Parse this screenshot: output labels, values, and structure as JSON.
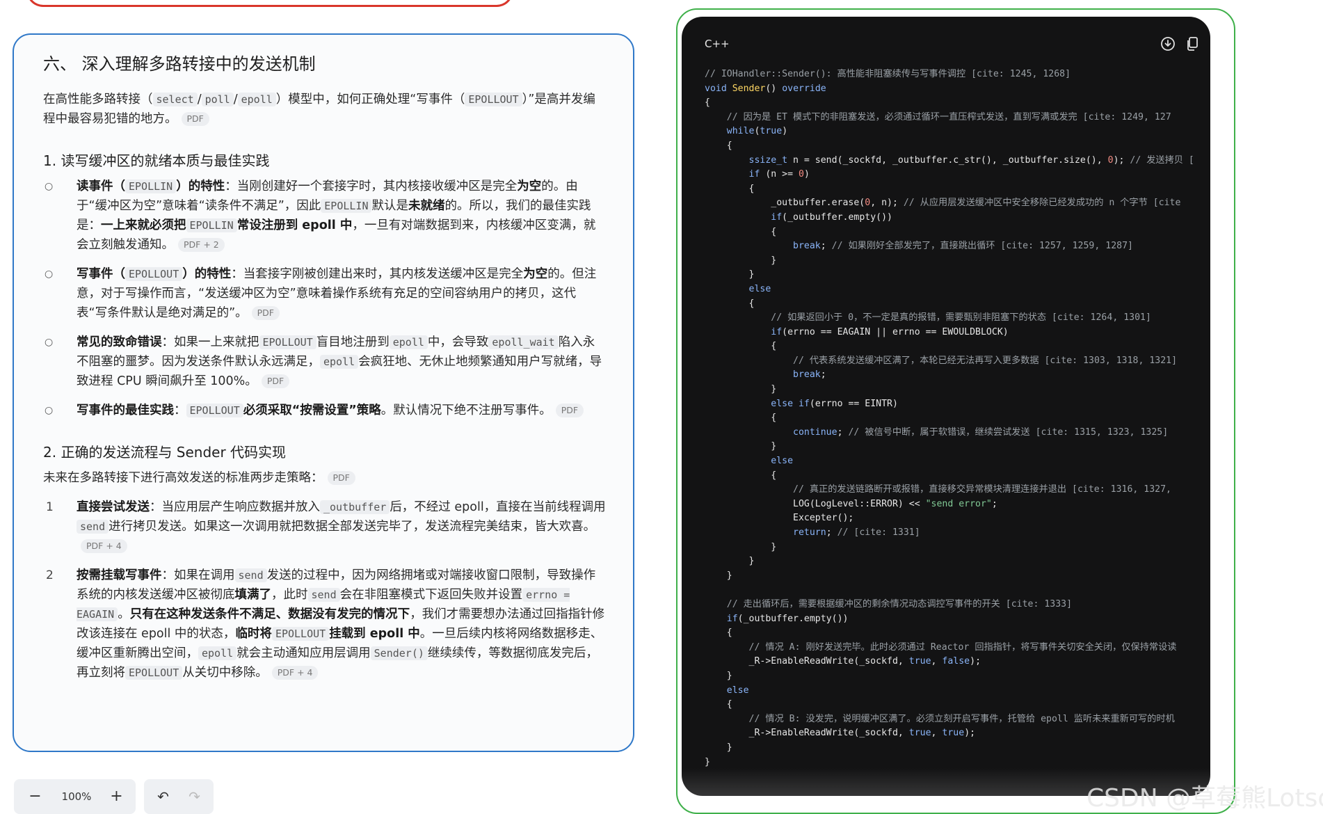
{
  "left": {
    "title": "六、 深入理解多路转接中的发送机制",
    "intro": {
      "t1": "在高性能多路转接（",
      "c1": "select",
      "s1": "/",
      "c2": "poll",
      "s2": "/",
      "c3": "epoll",
      "t2": "）模型中，如何正确处理“写事件（",
      "c4": "EPOLLOUT",
      "t3": "）”是高并发编程中最容易犯错的地方。",
      "pdf": "PDF"
    },
    "section1": {
      "heading": "1. 读写缓冲区的就绪本质与最佳实践",
      "items": [
        {
          "b1": "读事件（",
          "c1": "EPOLLIN",
          "b2": "）的特性",
          "t1": "：当刚创建好一个套接字时，其内核接收缓冲区是完全",
          "b3": "为空",
          "t2": "的。由于“缓冲区为空”意味着“读条件不满足”，因此",
          "c2": "EPOLLIN",
          "t3": "默认是",
          "b4": "未就绪",
          "t4": "的。所以，我们的最佳实践是：",
          "b5": "一上来就必须把",
          "c3": "EPOLLIN",
          "b6": "常设注册到 epoll 中",
          "t5": "，一旦有对端数据到来，内核缓冲区变满，就会立刻触发通知。",
          "pdf": "PDF + 2"
        },
        {
          "b1": "写事件（",
          "c1": "EPOLLOUT",
          "b2": "）的特性",
          "t1": "：当套接字刚被创建出来时，其内核发送缓冲区是完全",
          "b3": "为空",
          "t2": "的。但注意，对于写操作而言，“发送缓冲区为空”意味着操作系统有充足的空间容纳用户的拷贝，这代表“写条件默认是绝对满足的”。",
          "pdf": "PDF"
        },
        {
          "b1": "常见的致命错误",
          "t1": "：如果一上来就把",
          "c1": "EPOLLOUT",
          "t2": "盲目地注册到",
          "c2": "epoll",
          "t3": "中，会导致",
          "c3": "epoll_wait",
          "t4": "陷入永不阻塞的噩梦。因为发送条件默认永远满足，",
          "c4": "epoll",
          "t5": "会疯狂地、无休止地频繁通知用户写就绪，导致进程 CPU 瞬间飙升至 100%。",
          "pdf": "PDF"
        },
        {
          "b1": "写事件的最佳实践",
          "t1": "：",
          "c1": "EPOLLOUT",
          "b2": "必须采取“按需设置”策略",
          "t2": "。默认情况下绝不注册写事件。",
          "pdf": "PDF"
        }
      ]
    },
    "section2": {
      "heading": "2. 正确的发送流程与 Sender 代码实现",
      "intro": "未来在多路转接下进行高效发送的标准两步走策略：",
      "intro_pdf": "PDF",
      "items": [
        {
          "num": "1",
          "b1": "直接尝试发送",
          "t1": "：当应用层产生响应数据并放入",
          "c1": "_outbuffer",
          "t2": "后，不经过 epoll，直接在当前线程调用",
          "c2": "send",
          "t3": "进行拷贝发送。如果这一次调用就把数据全部发送完毕了，发送流程完美结束，皆大欢喜。",
          "pdf": "PDF + 4"
        },
        {
          "num": "2",
          "b1": "按需挂载写事件",
          "t1": "：如果在调用",
          "c1": "send",
          "t2": "发送的过程中，因为网络拥堵或对端接收窗口限制，导致操作系统的内核发送缓冲区被彻底",
          "b2": "填满了",
          "t3": "，此时",
          "c2": "send",
          "t4": "会在非阻塞模式下返回失败并设置",
          "c3": "errno = EAGAIN",
          "t5": "。",
          "b3": "只有在这种发送条件不满足、数据没有发完的情况下",
          "t6": "，我们才需要想办法通过回指指针修改该连接在 epoll 中的状态，",
          "b4": "临时将",
          "c4": "EPOLLOUT",
          "b5": "挂载到 epoll 中",
          "t7": "。一旦后续内核将网络数据移走、缓冲区重新腾出空间，",
          "c5": "epoll",
          "t8": "就会主动通知应用层调用",
          "c6": "Sender()",
          "t9": "继续续传，等数据彻底发完后，再立刻将",
          "c7": "EPOLLOUT",
          "t10": "从关切中移除。",
          "pdf": "PDF + 4"
        }
      ]
    }
  },
  "toolbar": {
    "zoom_out": "−",
    "zoom_level": "100%",
    "zoom_in": "+",
    "undo": "↶",
    "redo": "↷"
  },
  "code_panel": {
    "language": "C++",
    "lines": [
      "// IOHandler::Sender(): 高性能非阻塞续传与写事件调控 [cite: 1245, 1268]",
      "void Sender() override",
      "{",
      "    // 因为是 ET 模式下的非阻塞发送，必须通过循环一直压榨式发送，直到写满或发完 [cite: 1249, 127",
      "    while(true)",
      "    {",
      "        ssize_t n = send(_sockfd, _outbuffer.c_str(), _outbuffer.size(), 0); // 发送拷贝 [",
      "        if (n >= 0)",
      "        {",
      "            _outbuffer.erase(0, n); // 从应用层发送缓冲区中安全移除已经发成功的 n 个字节 [cite",
      "            if(_outbuffer.empty())",
      "            {",
      "                break; // 如果刚好全部发完了，直接跳出循环 [cite: 1257, 1259, 1287]",
      "            }",
      "        }",
      "        else",
      "        {",
      "            // 如果返回小于 0，不一定是真的报错，需要甄别非阻塞下的状态 [cite: 1264, 1301]",
      "            if(errno == EAGAIN || errno == EWOULDBLOCK)",
      "            {",
      "                // 代表系统发送缓冲区满了，本轮已经无法再写入更多数据 [cite: 1303, 1318, 1321]",
      "                break;",
      "            }",
      "            else if(errno == EINTR)",
      "            {",
      "                continue; // 被信号中断，属于软错误，继续尝试发送 [cite: 1315, 1323, 1325]",
      "            }",
      "            else",
      "            {",
      "                // 真正的发送链路断开或报错，直接移交异常模块清理连接并退出 [cite: 1316, 1327,",
      "                LOG(LogLevel::ERROR) << \"send error\";",
      "                Excepter();",
      "                return; // [cite: 1331]",
      "            }",
      "        }",
      "    }",
      "",
      "    // 走出循环后，需要根据缓冲区的剩余情况动态调控写事件的开关 [cite: 1333]",
      "    if(_outbuffer.empty())",
      "    {",
      "        // 情况 A: 刚好发送完毕。此时必须通过 Reactor 回指指针，将写事件关切安全关闭，仅保持常设读",
      "        _R->EnableReadWrite(_sockfd, true, false);",
      "    }",
      "    else",
      "    {",
      "        // 情况 B: 没发完，说明缓冲区满了。必须立刻开启写事件，托管给 epoll 监听未来重新可写的时机",
      "        _R->EnableReadWrite(_sockfd, true, true);",
      "    }",
      "}"
    ]
  },
  "watermark": "CSDN @草莓熊Lotso",
  "colors": {
    "left_border": "#2f78c8",
    "right_border": "#3fb04a",
    "top_border": "#d9362b",
    "code_bg": "#131314"
  }
}
